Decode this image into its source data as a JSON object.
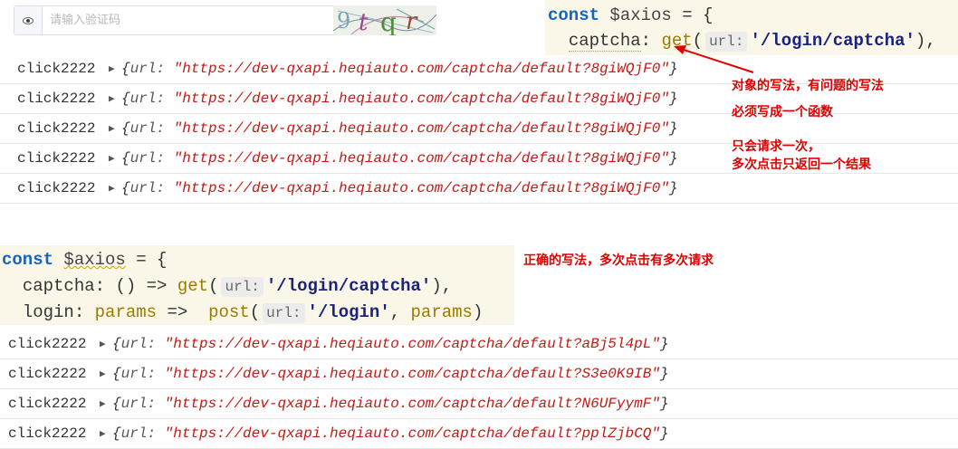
{
  "captcha": {
    "placeholder": "请输入验证码",
    "image_text": "9tqr",
    "eye_icon": "eye-icon"
  },
  "code_top": {
    "kw": "const",
    "var": "$axios",
    "eq_brace": " = {",
    "prop": "captcha",
    "colon": ": ",
    "fn": "get",
    "hint": "url:",
    "str": "'/login/captcha'",
    "tail": "),"
  },
  "console_top": {
    "rows": [
      {
        "label": "click2222",
        "key": "url:",
        "url": "\"https://dev-qxapi.heqiauto.com/captcha/default?8giWQjF0\""
      },
      {
        "label": "click2222",
        "key": "url:",
        "url": "\"https://dev-qxapi.heqiauto.com/captcha/default?8giWQjF0\""
      },
      {
        "label": "click2222",
        "key": "url:",
        "url": "\"https://dev-qxapi.heqiauto.com/captcha/default?8giWQjF0\""
      },
      {
        "label": "click2222",
        "key": "url:",
        "url": "\"https://dev-qxapi.heqiauto.com/captcha/default?8giWQjF0\""
      },
      {
        "label": "click2222",
        "key": "url:",
        "url": "\"https://dev-qxapi.heqiauto.com/captcha/default?8giWQjF0\""
      }
    ]
  },
  "notes": {
    "wrong1": "对象的写法，有问题的写法",
    "wrong2": "必须写成一个函数",
    "wrong3": "只会请求一次，\n多次点击只返回一个结果",
    "right": "正确的写法，多次点击有多次请求"
  },
  "code_bottom": {
    "kw": "const",
    "var": "$axios",
    "eq_brace": " = {",
    "l2_prop": "captcha",
    "l2_mid": ": () => ",
    "l2_fn": "get",
    "l2_hint": "url:",
    "l2_str": "'/login/captcha'",
    "l2_tail": "),",
    "l3_prop": "login",
    "l3_mid": ": ",
    "l3_param": "params",
    "l3_arrow": " =>  ",
    "l3_fn": "post",
    "l3_hint": "url:",
    "l3_str": "'/login'",
    "l3_sep": ", ",
    "l3_param2": "params",
    "l3_tail": ")"
  },
  "console_bottom": {
    "rows": [
      {
        "label": "click2222",
        "key": "url:",
        "url": "\"https://dev-qxapi.heqiauto.com/captcha/default?aBj5l4pL\""
      },
      {
        "label": "click2222",
        "key": "url:",
        "url": "\"https://dev-qxapi.heqiauto.com/captcha/default?S3e0K9IB\""
      },
      {
        "label": "click2222",
        "key": "url:",
        "url": "\"https://dev-qxapi.heqiauto.com/captcha/default?N6UFyymF\""
      },
      {
        "label": "click2222",
        "key": "url:",
        "url": "\"https://dev-qxapi.heqiauto.com/captcha/default?pplZjbCQ\""
      }
    ]
  },
  "colors": {
    "annotation": "#e00000",
    "url_string": "#c41a16",
    "keyword": "#1565c0",
    "code_bg": "#fbf7e8"
  }
}
